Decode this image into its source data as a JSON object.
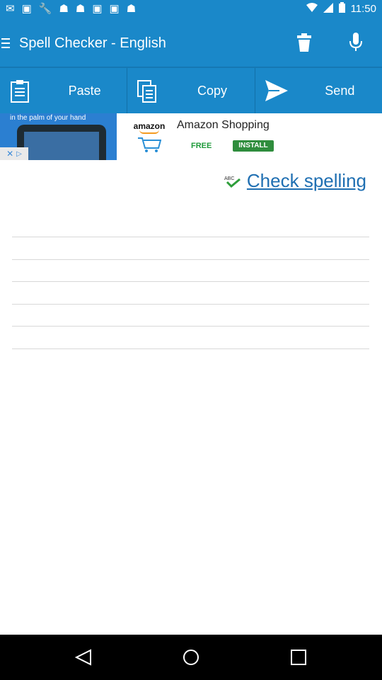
{
  "status": {
    "time": "11:50",
    "left_icons": [
      "mail-icon",
      "image-icon",
      "wrench-icon",
      "android-icon",
      "android-icon",
      "image-icon",
      "image-icon",
      "android-icon"
    ]
  },
  "appbar": {
    "title": "Spell Checker - English",
    "trash_icon": "trash-icon",
    "mic_icon": "microphone-icon",
    "bg_color": "#1a88c9"
  },
  "toolbar": {
    "paste_label": "Paste",
    "copy_label": "Copy",
    "send_label": "Send"
  },
  "ad": {
    "tagline": "in the palm of your hand",
    "brand": "amazon",
    "title": "Amazon Shopping",
    "free_label": "FREE",
    "install_label": "INSTALL"
  },
  "main": {
    "check_spelling_label": "Check spelling",
    "abc_label": "ABC"
  }
}
